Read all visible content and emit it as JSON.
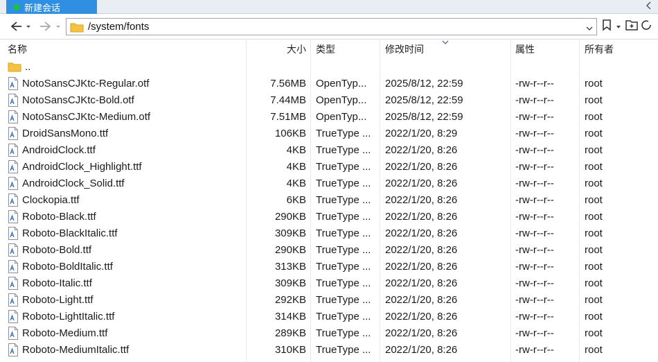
{
  "tab": {
    "label": "新建会话",
    "status_color": "#19c437"
  },
  "address": {
    "path": "/system/fonts"
  },
  "columns": {
    "name": "名称",
    "size": "大小",
    "type": "类型",
    "modified": "修改时间",
    "attributes": "属性",
    "owner": "所有者"
  },
  "parent": {
    "name": ".."
  },
  "files": [
    {
      "name": "NotoSansCJKtc-Regular.otf",
      "size": "7.56MB",
      "type": "OpenTyp...",
      "modified": "2025/8/12, 22:59",
      "attr": "-rw-r--r--",
      "owner": "root"
    },
    {
      "name": "NotoSansCJKtc-Bold.otf",
      "size": "7.44MB",
      "type": "OpenTyp...",
      "modified": "2025/8/12, 22:59",
      "attr": "-rw-r--r--",
      "owner": "root"
    },
    {
      "name": "NotoSansCJKtc-Medium.otf",
      "size": "7.51MB",
      "type": "OpenTyp...",
      "modified": "2025/8/12, 22:59",
      "attr": "-rw-r--r--",
      "owner": "root"
    },
    {
      "name": "DroidSansMono.ttf",
      "size": "106KB",
      "type": "TrueType ...",
      "modified": "2022/1/20, 8:29",
      "attr": "-rw-r--r--",
      "owner": "root"
    },
    {
      "name": "AndroidClock.ttf",
      "size": "4KB",
      "type": "TrueType ...",
      "modified": "2022/1/20, 8:26",
      "attr": "-rw-r--r--",
      "owner": "root"
    },
    {
      "name": "AndroidClock_Highlight.ttf",
      "size": "4KB",
      "type": "TrueType ...",
      "modified": "2022/1/20, 8:26",
      "attr": "-rw-r--r--",
      "owner": "root"
    },
    {
      "name": "AndroidClock_Solid.ttf",
      "size": "4KB",
      "type": "TrueType ...",
      "modified": "2022/1/20, 8:26",
      "attr": "-rw-r--r--",
      "owner": "root"
    },
    {
      "name": "Clockopia.ttf",
      "size": "6KB",
      "type": "TrueType ...",
      "modified": "2022/1/20, 8:26",
      "attr": "-rw-r--r--",
      "owner": "root"
    },
    {
      "name": "Roboto-Black.ttf",
      "size": "290KB",
      "type": "TrueType ...",
      "modified": "2022/1/20, 8:26",
      "attr": "-rw-r--r--",
      "owner": "root"
    },
    {
      "name": "Roboto-BlackItalic.ttf",
      "size": "309KB",
      "type": "TrueType ...",
      "modified": "2022/1/20, 8:26",
      "attr": "-rw-r--r--",
      "owner": "root"
    },
    {
      "name": "Roboto-Bold.ttf",
      "size": "290KB",
      "type": "TrueType ...",
      "modified": "2022/1/20, 8:26",
      "attr": "-rw-r--r--",
      "owner": "root"
    },
    {
      "name": "Roboto-BoldItalic.ttf",
      "size": "313KB",
      "type": "TrueType ...",
      "modified": "2022/1/20, 8:26",
      "attr": "-rw-r--r--",
      "owner": "root"
    },
    {
      "name": "Roboto-Italic.ttf",
      "size": "309KB",
      "type": "TrueType ...",
      "modified": "2022/1/20, 8:26",
      "attr": "-rw-r--r--",
      "owner": "root"
    },
    {
      "name": "Roboto-Light.ttf",
      "size": "292KB",
      "type": "TrueType ...",
      "modified": "2022/1/20, 8:26",
      "attr": "-rw-r--r--",
      "owner": "root"
    },
    {
      "name": "Roboto-LightItalic.ttf",
      "size": "314KB",
      "type": "TrueType ...",
      "modified": "2022/1/20, 8:26",
      "attr": "-rw-r--r--",
      "owner": "root"
    },
    {
      "name": "Roboto-Medium.ttf",
      "size": "289KB",
      "type": "TrueType ...",
      "modified": "2022/1/20, 8:26",
      "attr": "-rw-r--r--",
      "owner": "root"
    },
    {
      "name": "Roboto-MediumItalic.ttf",
      "size": "310KB",
      "type": "TrueType ...",
      "modified": "2022/1/20, 8:26",
      "attr": "-rw-r--r--",
      "owner": "root"
    }
  ],
  "icons": {
    "back": "arrow-left-icon",
    "forward": "arrow-right-icon",
    "folder": "folder-icon",
    "file": "font-file-icon",
    "bookmark": "bookmark-icon",
    "new_folder": "new-folder-icon",
    "refresh": "refresh-icon"
  },
  "colors": {
    "tab_active": "#2f8fe0",
    "folder": "#f5c242"
  }
}
